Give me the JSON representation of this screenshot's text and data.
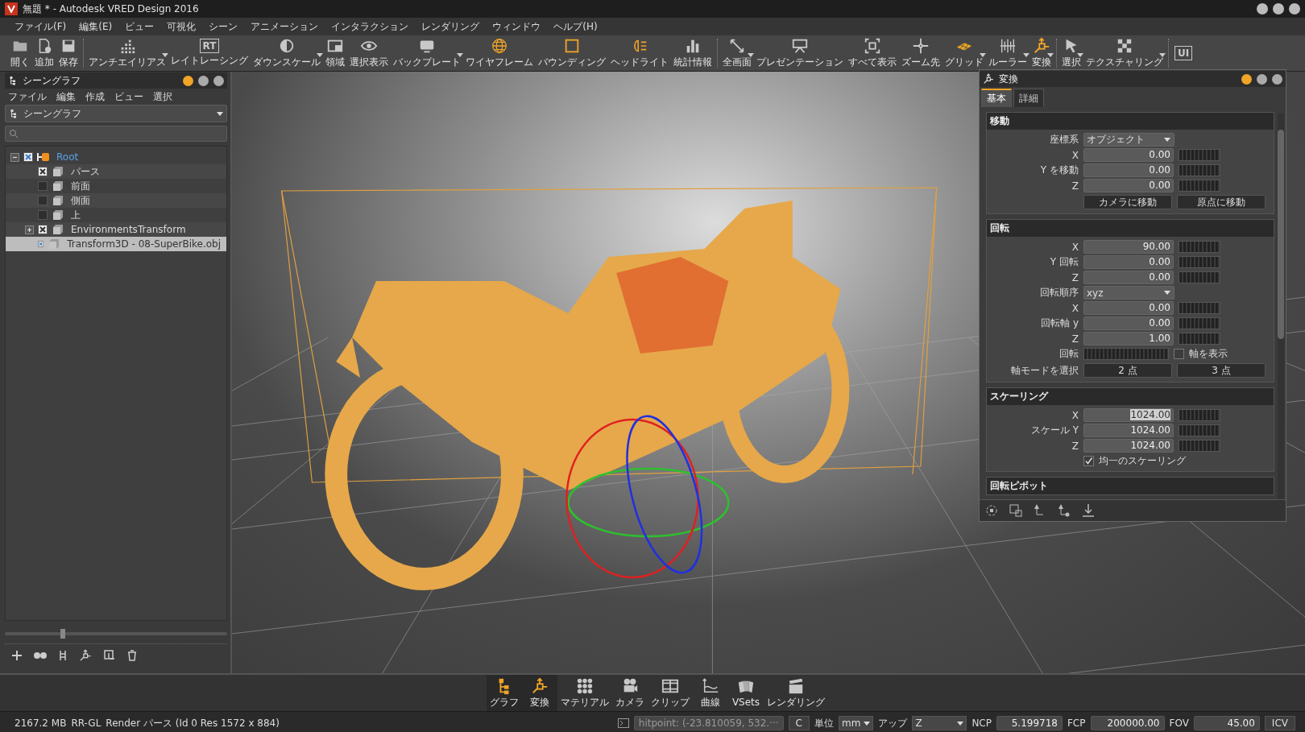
{
  "window": {
    "title": "無題 * - Autodesk VRED Design 2016"
  },
  "menu": [
    "ファイル(F)",
    "編集(E)",
    "ビュー",
    "可視化",
    "シーン",
    "アニメーション",
    "インタラクション",
    "レンダリング",
    "ウィンドウ",
    "ヘルプ(H)"
  ],
  "toolbar": [
    {
      "items": [
        {
          "label": "開く",
          "on": false,
          "has_menu": false
        },
        {
          "label": "追加",
          "on": false,
          "has_menu": false
        },
        {
          "label": "保存",
          "on": false,
          "has_menu": false
        }
      ]
    },
    {
      "items": [
        {
          "label": "アンチエイリアス",
          "on": false,
          "has_menu": true
        },
        {
          "label": "レイトレーシング",
          "glyph": "RT",
          "on": false,
          "has_menu": false
        },
        {
          "label": "ダウンスケール",
          "on": false,
          "has_menu": true
        },
        {
          "label": "領域",
          "on": false,
          "has_menu": false
        },
        {
          "label": "選択表示",
          "on": false,
          "has_menu": false
        },
        {
          "label": "バックプレート",
          "on": false,
          "has_menu": true
        },
        {
          "label": "ワイヤフレーム",
          "on": true,
          "has_menu": false
        },
        {
          "label": "バウンディング",
          "on": true,
          "has_menu": false
        },
        {
          "label": "ヘッドライト",
          "on": true,
          "has_menu": false
        },
        {
          "label": "統計情報",
          "on": false,
          "has_menu": false
        }
      ]
    },
    {
      "items": [
        {
          "label": "全画面",
          "on": false,
          "has_menu": true
        },
        {
          "label": "プレゼンテーション",
          "on": false,
          "has_menu": false
        },
        {
          "label": "すべて表示",
          "on": false,
          "has_menu": false
        },
        {
          "label": "ズーム先",
          "on": false,
          "has_menu": false
        },
        {
          "label": "グリッド",
          "on": true,
          "has_menu": true
        },
        {
          "label": "ルーラー",
          "on": false,
          "has_menu": true
        },
        {
          "label": "変換",
          "on": true,
          "has_menu": true
        }
      ]
    },
    {
      "items": [
        {
          "label": "選択",
          "on": false,
          "has_menu": true
        },
        {
          "label": "テクスチャリング",
          "on": false,
          "has_menu": true
        }
      ]
    },
    {
      "items": [
        {
          "glyph": "UI",
          "on": false,
          "has_menu": false
        }
      ]
    }
  ],
  "scene_graph": {
    "title": "シーングラフ",
    "menu": [
      "ファイル",
      "編集",
      "作成",
      "ビュー",
      "選択"
    ],
    "view_select": "シーングラフ",
    "tree": [
      {
        "label": "Root",
        "checked": true,
        "expanded": true,
        "selected": false,
        "children": [
          {
            "label": "パース",
            "checked": true,
            "selected": false
          },
          {
            "label": "前面",
            "checked": false,
            "selected": false
          },
          {
            "label": "側面",
            "checked": false,
            "selected": false
          },
          {
            "label": "上",
            "checked": false,
            "selected": false
          },
          {
            "label": "EnvironmentsTransform",
            "checked": true,
            "expanded": false,
            "selected": false
          },
          {
            "label": "Transform3D - 08-SuperBike.obj",
            "checked": true,
            "selected": true
          }
        ]
      }
    ],
    "slider": {
      "level": 0.26
    }
  },
  "transform_panel": {
    "title": "変換",
    "tabs": [
      {
        "label": "基本",
        "selected": true
      },
      {
        "label": "詳細",
        "selected": false
      }
    ],
    "sections": [
      {
        "title": "移動",
        "rows": [
          {
            "kind": "dropdown",
            "label": "座標系",
            "value": "オブジェクト"
          },
          {
            "kind": "number",
            "label": "X",
            "value": "0.00",
            "selected": false
          },
          {
            "kind": "number",
            "label": "Y を移動",
            "value": "0.00",
            "selected": false
          },
          {
            "kind": "number",
            "label": "Z",
            "value": "0.00",
            "selected": false
          },
          {
            "kind": "buttons",
            "buttons": [
              "カメラに移動",
              "原点に移動"
            ]
          }
        ]
      },
      {
        "title": "回転",
        "rows": [
          {
            "kind": "number",
            "label": "X",
            "value": "90.00",
            "selected": false
          },
          {
            "kind": "number",
            "label": "Y 回転",
            "value": "0.00",
            "selected": false
          },
          {
            "kind": "number",
            "label": "Z",
            "value": "0.00",
            "selected": false
          },
          {
            "kind": "dropdown",
            "label": "回転順序",
            "value": "xyz"
          },
          {
            "kind": "number",
            "label": "X",
            "value": "0.00",
            "selected": false
          },
          {
            "kind": "number",
            "label": "回転軸 y",
            "value": "0.00",
            "selected": false
          },
          {
            "kind": "number",
            "label": "Z",
            "value": "1.00",
            "selected": false
          },
          {
            "kind": "wheel_check",
            "label": "回転",
            "check_label": "軸を表示",
            "checked": false
          },
          {
            "kind": "buttons",
            "label": "軸モードを選択",
            "buttons": [
              "2 点",
              "3 点"
            ]
          }
        ]
      },
      {
        "title": "スケーリング",
        "rows": [
          {
            "kind": "number",
            "label": "X",
            "value": "1024.00",
            "selected": true
          },
          {
            "kind": "number",
            "label": "スケール Y",
            "value": "1024.00",
            "selected": false
          },
          {
            "kind": "number",
            "label": "Z",
            "value": "1024.00",
            "selected": false
          },
          {
            "kind": "checkbox",
            "label": "均一のスケーリング",
            "checked": true
          }
        ]
      },
      {
        "title": "回転ピボット"
      }
    ]
  },
  "dock": [
    {
      "label": "グラフ",
      "on": true
    },
    {
      "label": "変換",
      "on": true
    },
    {
      "label": "マテリアル",
      "on": false
    },
    {
      "label": "カメラ",
      "on": false
    },
    {
      "label": "クリップ",
      "on": false
    },
    {
      "label": "曲線",
      "on": false
    },
    {
      "label": "VSets",
      "on": false
    },
    {
      "label": "レンダリング",
      "on": false
    }
  ],
  "status": {
    "memory": "2167.2 MB",
    "renderer": "RR-GL",
    "render_info": "Render パース (Id 0 Res 1572 x 884)",
    "hitpoint": "hitpoint: (-23.810059, 532.···",
    "c_button": "C",
    "unit_label": "単位",
    "unit": "mm",
    "up_label": "アップ",
    "up": "Z",
    "ncp_label": "NCP",
    "ncp": "5.199718",
    "fcp_label": "FCP",
    "fcp": "200000.00",
    "fov_label": "FOV",
    "fov": "45.00",
    "icv_button": "ICV"
  }
}
